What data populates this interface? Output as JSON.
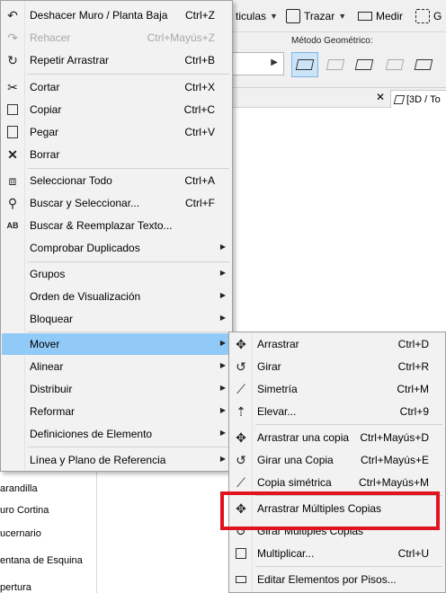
{
  "toolbar": {
    "items": [
      {
        "label": "ticulas",
        "icon": "grid-icon"
      },
      {
        "label": "Trazar",
        "icon": "trace-icon"
      },
      {
        "label": "Medir",
        "icon": "ruler-icon"
      }
    ]
  },
  "geometry": {
    "label": "Método Geométrico:"
  },
  "tabs": {
    "view_tab": "[3D / To"
  },
  "left_panel": {
    "items": [
      "arandilla",
      "uro Cortina",
      "ucernario",
      "entana de Esquina",
      "pertura"
    ]
  },
  "main_menu": {
    "items": [
      {
        "label": "Deshacer Muro / Planta Baja",
        "shortcut": "Ctrl+Z",
        "icon": "undo-icon",
        "disabled": false
      },
      {
        "label": "Rehacer",
        "shortcut": "Ctrl+Mayús+Z",
        "icon": "redo-icon",
        "disabled": true
      },
      {
        "label": "Repetir Arrastrar",
        "shortcut": "Ctrl+B",
        "icon": "repeat-icon",
        "disabled": false
      },
      {
        "label": "Cortar",
        "shortcut": "Ctrl+X",
        "icon": "scissors-icon",
        "disabled": false
      },
      {
        "label": "Copiar",
        "shortcut": "Ctrl+C",
        "icon": "copy-icon",
        "disabled": false
      },
      {
        "label": "Pegar",
        "shortcut": "Ctrl+V",
        "icon": "paste-icon",
        "disabled": false
      },
      {
        "label": "Borrar",
        "shortcut": "",
        "icon": "delete-x-icon",
        "disabled": false
      },
      {
        "label": "Seleccionar Todo",
        "shortcut": "Ctrl+A",
        "icon": "select-all-icon",
        "disabled": false
      },
      {
        "label": "Buscar y Seleccionar...",
        "shortcut": "Ctrl+F",
        "icon": "find-select-icon",
        "disabled": false
      },
      {
        "label": "Buscar & Reemplazar Texto...",
        "shortcut": "",
        "icon": "find-replace-icon",
        "disabled": false
      },
      {
        "label": "Comprobar Duplicados",
        "shortcut": "",
        "icon": "",
        "disabled": false
      },
      {
        "label": "Grupos",
        "shortcut": "",
        "icon": "",
        "disabled": false
      },
      {
        "label": "Orden de Visualización",
        "shortcut": "",
        "icon": "",
        "disabled": false
      },
      {
        "label": "Bloquear",
        "shortcut": "",
        "icon": "",
        "disabled": false
      },
      {
        "label": "Mover",
        "shortcut": "",
        "icon": "",
        "disabled": false
      },
      {
        "label": "Alinear",
        "shortcut": "",
        "icon": "",
        "disabled": false
      },
      {
        "label": "Distribuir",
        "shortcut": "",
        "icon": "",
        "disabled": false
      },
      {
        "label": "Reformar",
        "shortcut": "",
        "icon": "",
        "disabled": false
      },
      {
        "label": "Definiciones de Elemento",
        "shortcut": "",
        "icon": "",
        "disabled": false
      },
      {
        "label": "Línea y Plano de Referencia",
        "shortcut": "",
        "icon": "",
        "disabled": false
      }
    ]
  },
  "sub_menu": {
    "items": [
      {
        "label": "Arrastrar",
        "shortcut": "Ctrl+D",
        "icon": "drag-icon"
      },
      {
        "label": "Girar",
        "shortcut": "Ctrl+R",
        "icon": "rotate-icon"
      },
      {
        "label": "Simetría",
        "shortcut": "Ctrl+M",
        "icon": "mirror-icon"
      },
      {
        "label": "Elevar...",
        "shortcut": "Ctrl+9",
        "icon": "elevate-icon"
      },
      {
        "label": "Arrastrar una copia",
        "shortcut": "Ctrl+Mayús+D",
        "icon": "drag-copy-icon"
      },
      {
        "label": "Girar una Copia",
        "shortcut": "Ctrl+Mayús+E",
        "icon": "rotate-copy-icon"
      },
      {
        "label": "Copia simétrica",
        "shortcut": "Ctrl+Mayús+M",
        "icon": "mirror-copy-icon"
      },
      {
        "label": "Arrastrar Múltiples Copias",
        "shortcut": "",
        "icon": "drag-multiple-icon"
      },
      {
        "label": "Girar Múltiples Copias",
        "shortcut": "",
        "icon": "rotate-multiple-icon"
      },
      {
        "label": "Multiplicar...",
        "shortcut": "Ctrl+U",
        "icon": "multiply-icon"
      },
      {
        "label": "Editar Elementos por Pisos...",
        "shortcut": "",
        "icon": "edit-by-story-icon"
      }
    ]
  },
  "colors": {
    "highlight": "#91c9f7",
    "annotation_box": "#e0141e"
  }
}
